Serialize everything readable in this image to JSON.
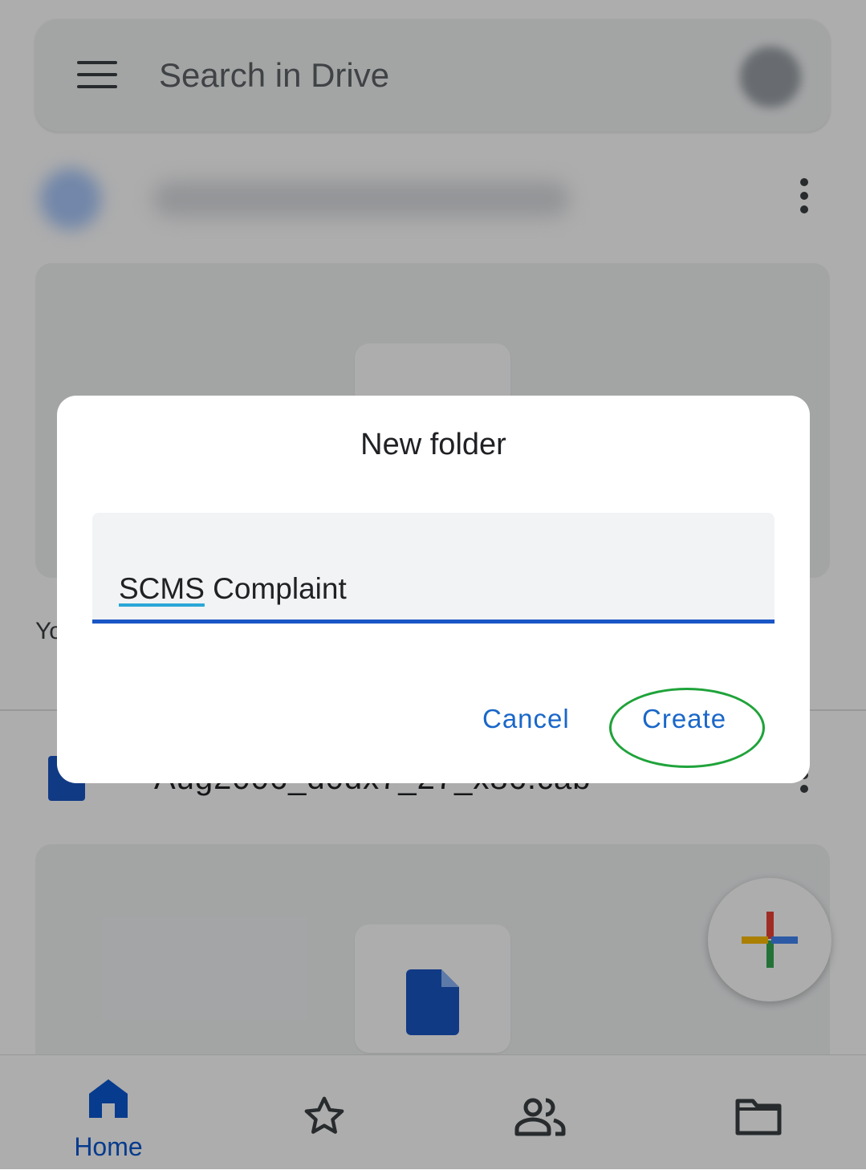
{
  "search": {
    "placeholder": "Search in Drive"
  },
  "suggestion": {
    "truncated_text": "Yo"
  },
  "file_row": {
    "name": "Aug2006_d0dx7_27_x86.cab"
  },
  "bottom_nav": {
    "items": [
      {
        "label": "Home",
        "icon": "home-icon",
        "active": true
      },
      {
        "label": "",
        "icon": "star-icon"
      },
      {
        "label": "",
        "icon": "shared-icon"
      },
      {
        "label": "",
        "icon": "folder-icon"
      }
    ]
  },
  "fab": {
    "icon": "plus-icon"
  },
  "dialog": {
    "title": "New folder",
    "field_value_part1": "SCMS",
    "field_value_part2": " Complaint",
    "cancel_label": "Cancel",
    "create_label": "Create"
  },
  "colors": {
    "accent": "#1a56c5",
    "button_text": "#1a67c9",
    "highlight": "#1fa33a"
  }
}
